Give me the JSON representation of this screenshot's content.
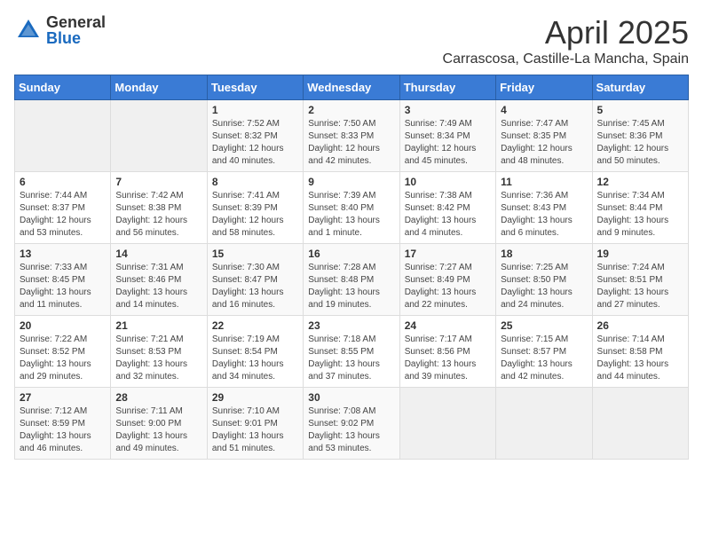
{
  "header": {
    "logo_general": "General",
    "logo_blue": "Blue",
    "month": "April 2025",
    "location": "Carrascosa, Castille-La Mancha, Spain"
  },
  "weekdays": [
    "Sunday",
    "Monday",
    "Tuesday",
    "Wednesday",
    "Thursday",
    "Friday",
    "Saturday"
  ],
  "weeks": [
    [
      {
        "day": "",
        "info": ""
      },
      {
        "day": "",
        "info": ""
      },
      {
        "day": "1",
        "info": "Sunrise: 7:52 AM\nSunset: 8:32 PM\nDaylight: 12 hours and 40 minutes."
      },
      {
        "day": "2",
        "info": "Sunrise: 7:50 AM\nSunset: 8:33 PM\nDaylight: 12 hours and 42 minutes."
      },
      {
        "day": "3",
        "info": "Sunrise: 7:49 AM\nSunset: 8:34 PM\nDaylight: 12 hours and 45 minutes."
      },
      {
        "day": "4",
        "info": "Sunrise: 7:47 AM\nSunset: 8:35 PM\nDaylight: 12 hours and 48 minutes."
      },
      {
        "day": "5",
        "info": "Sunrise: 7:45 AM\nSunset: 8:36 PM\nDaylight: 12 hours and 50 minutes."
      }
    ],
    [
      {
        "day": "6",
        "info": "Sunrise: 7:44 AM\nSunset: 8:37 PM\nDaylight: 12 hours and 53 minutes."
      },
      {
        "day": "7",
        "info": "Sunrise: 7:42 AM\nSunset: 8:38 PM\nDaylight: 12 hours and 56 minutes."
      },
      {
        "day": "8",
        "info": "Sunrise: 7:41 AM\nSunset: 8:39 PM\nDaylight: 12 hours and 58 minutes."
      },
      {
        "day": "9",
        "info": "Sunrise: 7:39 AM\nSunset: 8:40 PM\nDaylight: 13 hours and 1 minute."
      },
      {
        "day": "10",
        "info": "Sunrise: 7:38 AM\nSunset: 8:42 PM\nDaylight: 13 hours and 4 minutes."
      },
      {
        "day": "11",
        "info": "Sunrise: 7:36 AM\nSunset: 8:43 PM\nDaylight: 13 hours and 6 minutes."
      },
      {
        "day": "12",
        "info": "Sunrise: 7:34 AM\nSunset: 8:44 PM\nDaylight: 13 hours and 9 minutes."
      }
    ],
    [
      {
        "day": "13",
        "info": "Sunrise: 7:33 AM\nSunset: 8:45 PM\nDaylight: 13 hours and 11 minutes."
      },
      {
        "day": "14",
        "info": "Sunrise: 7:31 AM\nSunset: 8:46 PM\nDaylight: 13 hours and 14 minutes."
      },
      {
        "day": "15",
        "info": "Sunrise: 7:30 AM\nSunset: 8:47 PM\nDaylight: 13 hours and 16 minutes."
      },
      {
        "day": "16",
        "info": "Sunrise: 7:28 AM\nSunset: 8:48 PM\nDaylight: 13 hours and 19 minutes."
      },
      {
        "day": "17",
        "info": "Sunrise: 7:27 AM\nSunset: 8:49 PM\nDaylight: 13 hours and 22 minutes."
      },
      {
        "day": "18",
        "info": "Sunrise: 7:25 AM\nSunset: 8:50 PM\nDaylight: 13 hours and 24 minutes."
      },
      {
        "day": "19",
        "info": "Sunrise: 7:24 AM\nSunset: 8:51 PM\nDaylight: 13 hours and 27 minutes."
      }
    ],
    [
      {
        "day": "20",
        "info": "Sunrise: 7:22 AM\nSunset: 8:52 PM\nDaylight: 13 hours and 29 minutes."
      },
      {
        "day": "21",
        "info": "Sunrise: 7:21 AM\nSunset: 8:53 PM\nDaylight: 13 hours and 32 minutes."
      },
      {
        "day": "22",
        "info": "Sunrise: 7:19 AM\nSunset: 8:54 PM\nDaylight: 13 hours and 34 minutes."
      },
      {
        "day": "23",
        "info": "Sunrise: 7:18 AM\nSunset: 8:55 PM\nDaylight: 13 hours and 37 minutes."
      },
      {
        "day": "24",
        "info": "Sunrise: 7:17 AM\nSunset: 8:56 PM\nDaylight: 13 hours and 39 minutes."
      },
      {
        "day": "25",
        "info": "Sunrise: 7:15 AM\nSunset: 8:57 PM\nDaylight: 13 hours and 42 minutes."
      },
      {
        "day": "26",
        "info": "Sunrise: 7:14 AM\nSunset: 8:58 PM\nDaylight: 13 hours and 44 minutes."
      }
    ],
    [
      {
        "day": "27",
        "info": "Sunrise: 7:12 AM\nSunset: 8:59 PM\nDaylight: 13 hours and 46 minutes."
      },
      {
        "day": "28",
        "info": "Sunrise: 7:11 AM\nSunset: 9:00 PM\nDaylight: 13 hours and 49 minutes."
      },
      {
        "day": "29",
        "info": "Sunrise: 7:10 AM\nSunset: 9:01 PM\nDaylight: 13 hours and 51 minutes."
      },
      {
        "day": "30",
        "info": "Sunrise: 7:08 AM\nSunset: 9:02 PM\nDaylight: 13 hours and 53 minutes."
      },
      {
        "day": "",
        "info": ""
      },
      {
        "day": "",
        "info": ""
      },
      {
        "day": "",
        "info": ""
      }
    ]
  ]
}
